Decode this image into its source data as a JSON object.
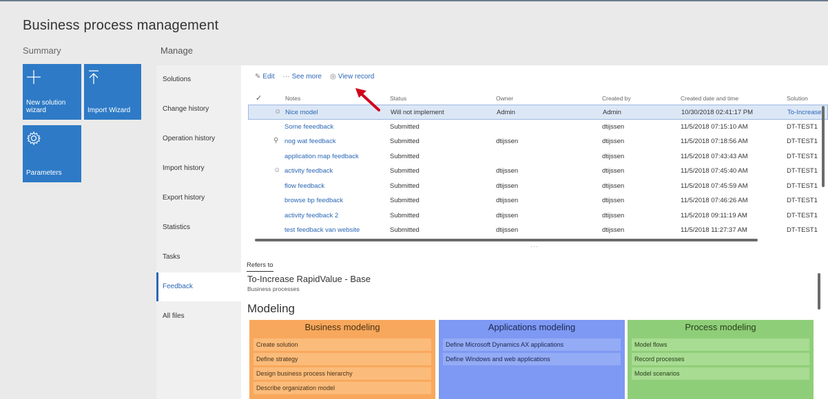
{
  "page": {
    "title": "Business process management"
  },
  "summary": {
    "label": "Summary",
    "tiles": [
      {
        "label": "New solution wizard",
        "icon": "plus-icon"
      },
      {
        "label": "Import Wizard",
        "icon": "upload-icon"
      },
      {
        "label": "Parameters",
        "icon": "gear-icon"
      }
    ]
  },
  "manage": {
    "label": "Manage",
    "items": [
      {
        "label": "Solutions"
      },
      {
        "label": "Change history"
      },
      {
        "label": "Operation history"
      },
      {
        "label": "Import history"
      },
      {
        "label": "Export history"
      },
      {
        "label": "Statistics"
      },
      {
        "label": "Tasks"
      },
      {
        "label": "Feedback",
        "active": true
      },
      {
        "label": "All files"
      }
    ]
  },
  "toolbar": {
    "edit": "Edit",
    "see_more": "See more",
    "view_record": "View record"
  },
  "grid": {
    "columns": [
      "Notes",
      "Status",
      "Owner",
      "Created by",
      "Created date and time",
      "Solution"
    ],
    "rows": [
      {
        "icon": "smiley-icon",
        "notes": "Nice model",
        "status": "Will not implement",
        "owner": "Admin",
        "created_by": "Admin",
        "created": "10/30/2018 02:41:17 PM",
        "solution": "To-Increase",
        "selected": true
      },
      {
        "icon": "",
        "notes": "Some feeedback",
        "status": "Submitted",
        "owner": "",
        "created_by": "dtijssen",
        "created": "11/5/2018 07:15:10 AM",
        "solution": "DT-TEST1"
      },
      {
        "icon": "lightbulb-icon",
        "notes": "nog wat feedback",
        "status": "Submitted",
        "owner": "dtijssen",
        "created_by": "dtijssen",
        "created": "11/5/2018 07:18:56 AM",
        "solution": "DT-TEST1"
      },
      {
        "icon": "",
        "notes": "application map feedback",
        "status": "Submitted",
        "owner": "",
        "created_by": "dtijssen",
        "created": "11/5/2018 07:43:43 AM",
        "solution": "DT-TEST1"
      },
      {
        "icon": "smiley-icon",
        "notes": "activity feedback",
        "status": "Submitted",
        "owner": "dtijssen",
        "created_by": "dtijssen",
        "created": "11/5/2018 07:45:40 AM",
        "solution": "DT-TEST1"
      },
      {
        "icon": "",
        "notes": "flow feedback",
        "status": "Submitted",
        "owner": "dtijssen",
        "created_by": "dtijssen",
        "created": "11/5/2018 07:45:59 AM",
        "solution": "DT-TEST1"
      },
      {
        "icon": "",
        "notes": "browse bp feedback",
        "status": "Submitted",
        "owner": "dtijssen",
        "created_by": "dtijssen",
        "created": "11/5/2018 07:46:26 AM",
        "solution": "DT-TEST1"
      },
      {
        "icon": "",
        "notes": "activity feedback 2",
        "status": "Submitted",
        "owner": "dtijssen",
        "created_by": "dtijssen",
        "created": "11/5/2018 09:11:19 AM",
        "solution": "DT-TEST1"
      },
      {
        "icon": "",
        "notes": "test feedback van website",
        "status": "Submitted",
        "owner": "dtijssen",
        "created_by": "dtijssen",
        "created": "11/5/2018 11:27:37 AM",
        "solution": "DT-TEST1"
      }
    ]
  },
  "refers": {
    "tab": "Refers to",
    "title": "To-Increase RapidValue - Base",
    "subtitle": "Business processes"
  },
  "modeling": {
    "title": "Modeling",
    "business": {
      "title": "Business modeling",
      "items": [
        "Create solution",
        "Define strategy",
        "Design business process hierarchy",
        "Describe organization model"
      ]
    },
    "applications": {
      "title": "Applications modeling",
      "items": [
        "Define Microsoft Dynamics AX applications",
        "Define Windows and web applications"
      ]
    },
    "process": {
      "title": "Process modeling",
      "items": [
        "Model flows",
        "Record processes",
        "Model scenarios"
      ]
    }
  },
  "colors": {
    "accent": "#2b67b5",
    "tile": "#2e7ac6",
    "business": "#f8a85d",
    "applications": "#7e99f3",
    "process": "#8fce78",
    "arrow": "#d0021b"
  }
}
